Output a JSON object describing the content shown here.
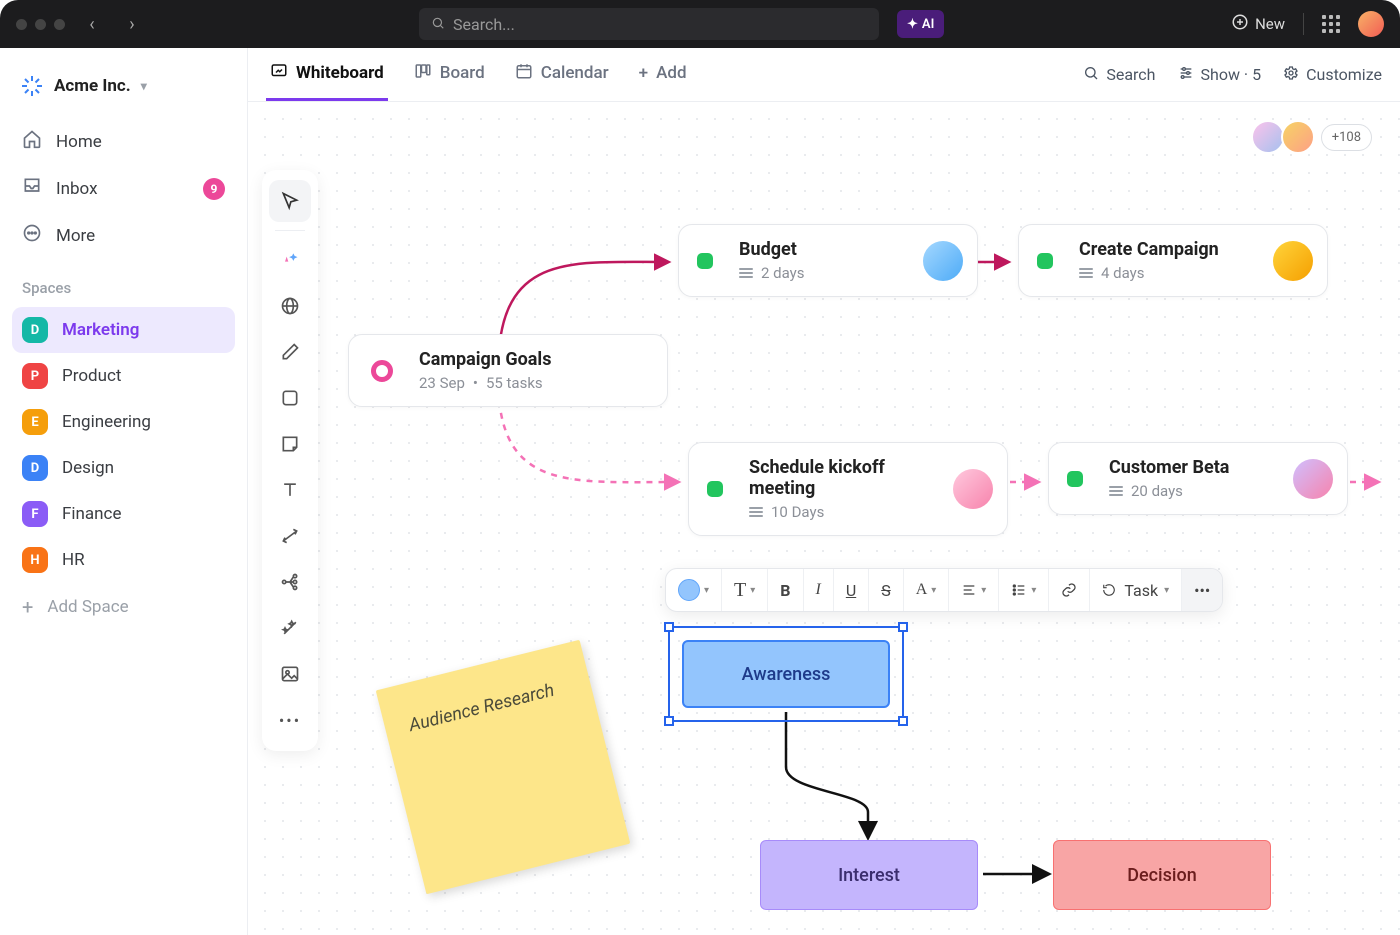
{
  "titlebar": {
    "search_placeholder": "Search...",
    "ai_label": "AI",
    "new_label": "New"
  },
  "workspace": {
    "name": "Acme Inc."
  },
  "nav": {
    "home": "Home",
    "inbox": "Inbox",
    "inbox_count": "9",
    "more": "More"
  },
  "spaces_label": "Spaces",
  "spaces": [
    {
      "letter": "D",
      "name": "Marketing",
      "color": "#14b8a6",
      "active": true
    },
    {
      "letter": "P",
      "name": "Product",
      "color": "#ef4444",
      "active": false
    },
    {
      "letter": "E",
      "name": "Engineering",
      "color": "#f59e0b",
      "active": false
    },
    {
      "letter": "D",
      "name": "Design",
      "color": "#3b82f6",
      "active": false
    },
    {
      "letter": "F",
      "name": "Finance",
      "color": "#8b5cf6",
      "active": false
    },
    {
      "letter": "H",
      "name": "HR",
      "color": "#f97316",
      "active": false
    }
  ],
  "add_space_label": "Add Space",
  "tabs": {
    "whiteboard": "Whiteboard",
    "board": "Board",
    "calendar": "Calendar",
    "add": "Add"
  },
  "tabbar_right": {
    "search": "Search",
    "show": "Show · 5",
    "customize": "Customize"
  },
  "collaborators_more": "+108",
  "cards": {
    "goals": {
      "title": "Campaign Goals",
      "date": "23 Sep",
      "tasks": "55 tasks"
    },
    "budget": {
      "title": "Budget",
      "duration": "2 days"
    },
    "campaign": {
      "title": "Create Campaign",
      "duration": "4 days"
    },
    "kickoff": {
      "title": "Schedule kickoff meeting",
      "duration": "10 Days"
    },
    "beta": {
      "title": "Customer Beta",
      "duration": "20 days"
    }
  },
  "sticky": {
    "text": "Audience Research"
  },
  "shapes": {
    "awareness": "Awareness",
    "interest": "Interest",
    "decision": "Decision"
  },
  "fmt": {
    "task_label": "Task"
  }
}
